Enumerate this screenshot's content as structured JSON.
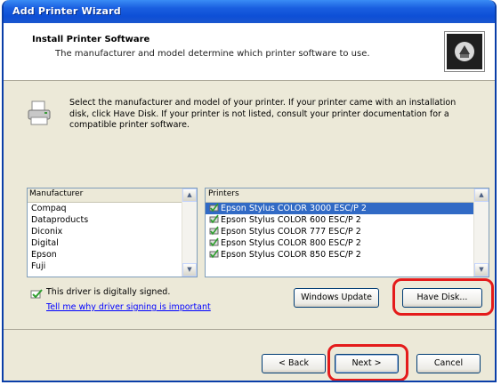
{
  "window": {
    "title": "Add Printer Wizard"
  },
  "header": {
    "title": "Install Printer Software",
    "subtitle": "The manufacturer and model determine which printer software to use."
  },
  "description": "Select the manufacturer and model of your printer. If your printer came with an installation disk, click Have Disk. If your printer is not listed, consult your printer documentation for a compatible printer software.",
  "manufacturer": {
    "label": "Manufacturer",
    "items": [
      "Compaq",
      "Dataproducts",
      "Diconix",
      "Digital",
      "Epson",
      "Fuji"
    ]
  },
  "printers": {
    "label": "Printers",
    "items": [
      {
        "text": "Epson Stylus COLOR 3000 ESC/P 2",
        "selected": true
      },
      {
        "text": "Epson Stylus COLOR 600 ESC/P 2",
        "selected": false
      },
      {
        "text": "Epson Stylus COLOR 777 ESC/P 2",
        "selected": false
      },
      {
        "text": "Epson Stylus COLOR 800 ESC/P 2",
        "selected": false
      },
      {
        "text": "Epson Stylus COLOR 850 ESC/P 2",
        "selected": false
      }
    ]
  },
  "signing": {
    "status": "This driver is digitally signed.",
    "link": "Tell me why driver signing is important"
  },
  "buttons": {
    "windows_update": "Windows Update",
    "have_disk": "Have Disk...",
    "back": "< Back",
    "next": "Next >",
    "cancel": "Cancel"
  },
  "highlight_color": "#e41b1b",
  "selection_color": "#316ac5",
  "icons": {
    "header": "printer-wizard-icon",
    "printer": "printer-icon",
    "signed": "signed-driver-icon",
    "list_item": "printer-item-icon"
  }
}
